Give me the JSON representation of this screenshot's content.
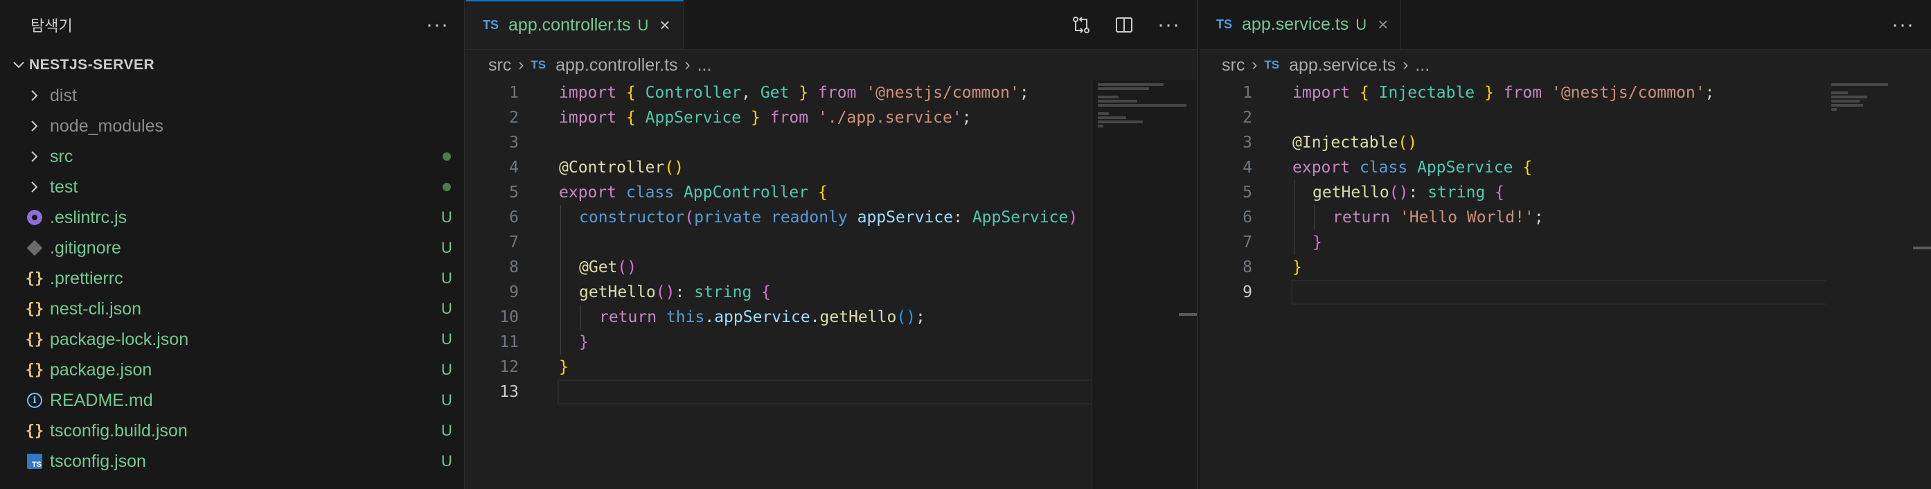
{
  "explorer": {
    "title": "탐색기",
    "more": "···",
    "project": "NESTJS-SERVER",
    "items": [
      {
        "label": "dist",
        "kind": "folder",
        "status": ""
      },
      {
        "label": "node_modules",
        "kind": "folder",
        "status": ""
      },
      {
        "label": "src",
        "kind": "folder",
        "status": "dot"
      },
      {
        "label": "test",
        "kind": "folder",
        "status": "dot"
      },
      {
        "label": ".eslintrc.js",
        "icon": "eslint-icon",
        "status": "U"
      },
      {
        "label": ".gitignore",
        "icon": "git-icon",
        "status": "U"
      },
      {
        "label": ".prettierrc",
        "icon": "json-braces-icon",
        "status": "U"
      },
      {
        "label": "nest-cli.json",
        "icon": "json-braces-icon",
        "status": "U"
      },
      {
        "label": "package-lock.json",
        "icon": "json-braces-icon",
        "status": "U"
      },
      {
        "label": "package.json",
        "icon": "json-braces-icon",
        "status": "U"
      },
      {
        "label": "README.md",
        "icon": "info-icon",
        "status": "U"
      },
      {
        "label": "tsconfig.build.json",
        "icon": "json-braces-icon",
        "status": "U"
      },
      {
        "label": "tsconfig.json",
        "icon": "ts-file-icon",
        "status": "U"
      }
    ]
  },
  "left_editor": {
    "tab": {
      "lang": "TS",
      "name": "app.controller.ts",
      "status": "U",
      "close": "×"
    },
    "breadcrumb": {
      "folder": "src",
      "lang": "TS",
      "file": "app.controller.ts",
      "more": "..."
    },
    "more": "···",
    "line_numbers": [
      "1",
      "2",
      "3",
      "4",
      "5",
      "6",
      "7",
      "8",
      "9",
      "10",
      "11",
      "12",
      "13"
    ]
  },
  "right_editor": {
    "tab": {
      "lang": "TS",
      "name": "app.service.ts",
      "status": "U",
      "close": "×"
    },
    "breadcrumb": {
      "folder": "src",
      "lang": "TS",
      "file": "app.service.ts",
      "more": "..."
    },
    "more": "···",
    "line_numbers": [
      "1",
      "2",
      "3",
      "4",
      "5",
      "6",
      "7",
      "8",
      "9"
    ]
  },
  "tokens": {
    "import": "import",
    "from": "from",
    "export": "export",
    "class": "class",
    "return": "return",
    "this": "this",
    "private": "private",
    "readonly": "readonly",
    "string": "string",
    "Controller": "Controller",
    "Get": "Get",
    "AppService": "AppService",
    "AppController": "AppController",
    "Injectable": "Injectable",
    "common": "'@nestjs/common'",
    "appservice_path": "'./app.service'",
    "dec_controller": "@Controller",
    "dec_get": "@Get",
    "dec_injectable": "@Injectable",
    "constructor": "constructor",
    "appService": "appService",
    "getHello": "getHello",
    "hello": "'Hello World!'",
    "lbrace": "{",
    "rbrace": "}",
    "lparen": "(",
    "rparen": ")",
    "semi": ";",
    "comma": ",",
    "colon": ":",
    "dot": "."
  },
  "colors": {
    "accent": "#0078d4",
    "untracked": "#73c991",
    "keyword": "#c586c0",
    "type": "#4ec9b0",
    "string": "#ce9178"
  }
}
